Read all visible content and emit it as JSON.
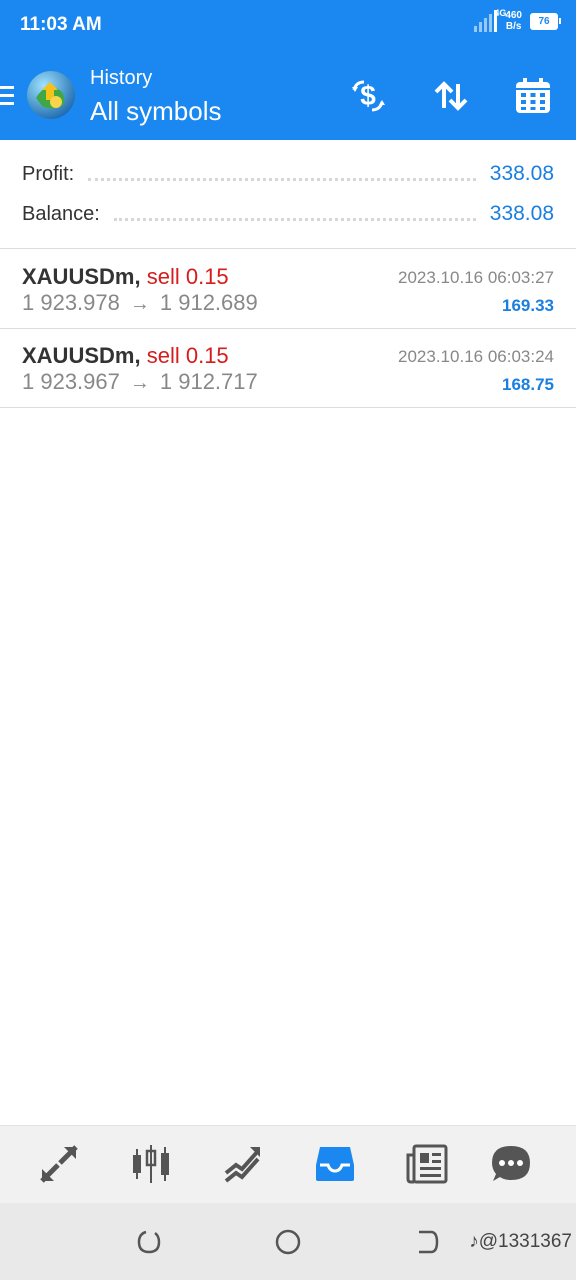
{
  "status_bar": {
    "time": "11:03 AM",
    "net_type": "4G",
    "speed_value": "460",
    "speed_unit": "B/s",
    "battery": "76"
  },
  "header": {
    "subtitle": "History",
    "title": "All symbols",
    "icons": [
      "menu-icon",
      "app-logo",
      "currency-exchange-icon",
      "sort-icon",
      "calendar-icon"
    ]
  },
  "summary": {
    "profit_label": "Profit:",
    "profit_value": "338.08",
    "balance_label": "Balance:",
    "balance_value": "338.08"
  },
  "deals": [
    {
      "symbol": "XAUUSDm",
      "separator": ",",
      "type": "sell 0.15",
      "open_price": "1 923.978",
      "arrow": "→",
      "close_price": "1 912.689",
      "time": "2023.10.16 06:03:27",
      "profit": "169.33"
    },
    {
      "symbol": "XAUUSDm",
      "separator": ",",
      "type": "sell 0.15",
      "open_price": "1 923.967",
      "arrow": "→",
      "close_price": "1 912.717",
      "time": "2023.10.16 06:03:24",
      "profit": "168.75"
    }
  ],
  "bottom_nav": {
    "items": [
      "quotes-icon",
      "chart-icon",
      "trade-icon",
      "history-icon",
      "news-icon",
      "messages-icon"
    ],
    "active": "history-icon"
  },
  "system_nav": {
    "watermark": "♪@1331367"
  },
  "colors": {
    "primary": "#1a88f0",
    "sell": "#d61c1c",
    "value": "#1a7fe0"
  }
}
